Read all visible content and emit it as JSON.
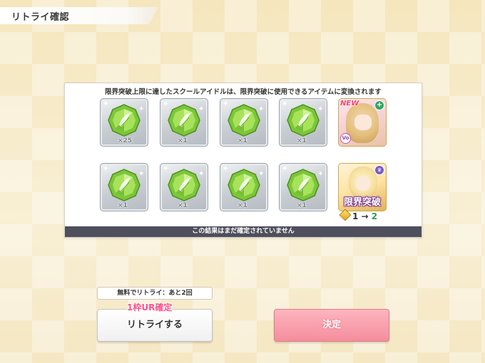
{
  "title": "リトライ確認",
  "panel": {
    "header": "限界突破上限に達したスクールアイドルは、限界突破に使用できるアイテムに変換されます",
    "footer": "この結果はまだ確定されていません",
    "items": [
      {
        "icon": "green-crystal-icon",
        "qty": "×25"
      },
      {
        "icon": "green-crystal-icon",
        "qty": "×1"
      },
      {
        "icon": "green-crystal-icon",
        "qty": "×1"
      },
      {
        "icon": "green-crystal-icon",
        "qty": "×1"
      },
      {
        "icon": "green-crystal-icon",
        "qty": "×1"
      },
      {
        "icon": "green-crystal-icon",
        "qty": "×1"
      },
      {
        "icon": "green-crystal-icon",
        "qty": "×1"
      },
      {
        "icon": "green-crystal-icon",
        "qty": "×1"
      }
    ],
    "new_card": {
      "badge": "NEW",
      "plus": "+",
      "vo": "Vo"
    },
    "limit_card": {
      "label": "限界突破",
      "from": "1",
      "arrow": "→",
      "to": "2"
    }
  },
  "retry": {
    "free_text": "無料でリトライ：あと2回",
    "ur_text": "1枠UR確定",
    "button_label": "リトライする"
  },
  "decide": {
    "button_label": "決定"
  },
  "colors": {
    "accent_pink": "#f58d9c",
    "green_crystal": "#8fd43a",
    "footer_bar": "#4e4f5c"
  }
}
